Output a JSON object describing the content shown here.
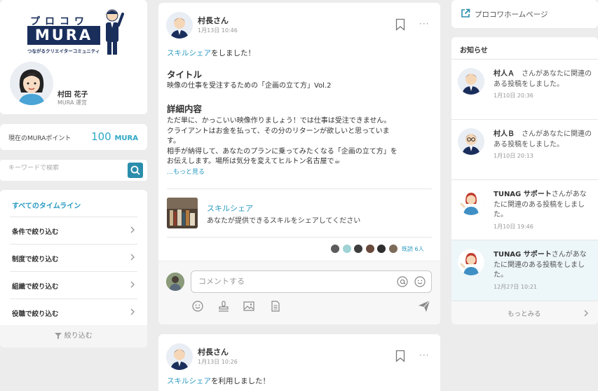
{
  "logo": {
    "top": "プロコワ",
    "main": "MURA",
    "sub": "つながるクリエイターコミュニティ"
  },
  "profile": {
    "name": "村田 花子",
    "role": "MURA 運営"
  },
  "points": {
    "label": "現在のMURAポイント",
    "value": "100",
    "unit": "MURA"
  },
  "search": {
    "placeholder": "キーワードで検索"
  },
  "filters": {
    "title": "すべてのタイムライン",
    "items": [
      "条件で絞り込む",
      "制度で絞り込む",
      "組織で絞り込む",
      "役職で絞り込む"
    ],
    "footer": "絞り込む"
  },
  "post1": {
    "author": "村長さん",
    "date": "1月13日 10:46",
    "action_link": "スキルシェア",
    "action_text": "をしました！",
    "title_label": "タイトル",
    "title_text": "映像の仕事を受注するための「企画の立て方」Vol.2",
    "detail_label": "詳細内容",
    "detail_line1": "ただ単に、かっこいい映像作りましょう！では仕事は受注できません。",
    "detail_line2": "クライアントはお金を払って、その分のリターンが欲しいと思っていま",
    "detail_line3": "す。",
    "detail_line4": "相手が納得して、あなたのプランに乗ってみたくなる「企画の立て方」を",
    "detail_line5": "お伝えします。場所は気分を変えてヒルトン名古屋で☕",
    "more": "…もっと見る",
    "share_title": "スキルシェア",
    "share_desc": "あなたが提供できるスキルをシェアしてください",
    "reaction_count": "既読 6人",
    "comment_placeholder": "コメントする"
  },
  "post2": {
    "author": "村長さん",
    "date": "1月13日 10:26",
    "action_link": "スキルシェア",
    "action_text": "を利用しました！"
  },
  "homepage_link": "プロコワホームページ",
  "notices": {
    "title": "お知らせ",
    "items": [
      {
        "name": "村人Ａ",
        "text": "さんがあなたに関連のある投稿をしました。",
        "date": "1月10日 20:36"
      },
      {
        "name": "村人Ｂ",
        "text": "さんがあなたに関連のある投稿をしました。",
        "date": "1月10日 20:13"
      },
      {
        "name": "TUNAG サポート",
        "text": "さんがあなたに関連のある投稿をしました。",
        "date": "1月10日 19:46"
      },
      {
        "name": "TUNAG サポート",
        "text": "さんがあなたに関連のある投稿をしました。",
        "date": "12月27日 10:21"
      }
    ],
    "more": "もっとみる"
  },
  "colors": {
    "accent": "#2a9ac1",
    "navy": "#1a2e5c",
    "search_button": "#2a8dab"
  }
}
